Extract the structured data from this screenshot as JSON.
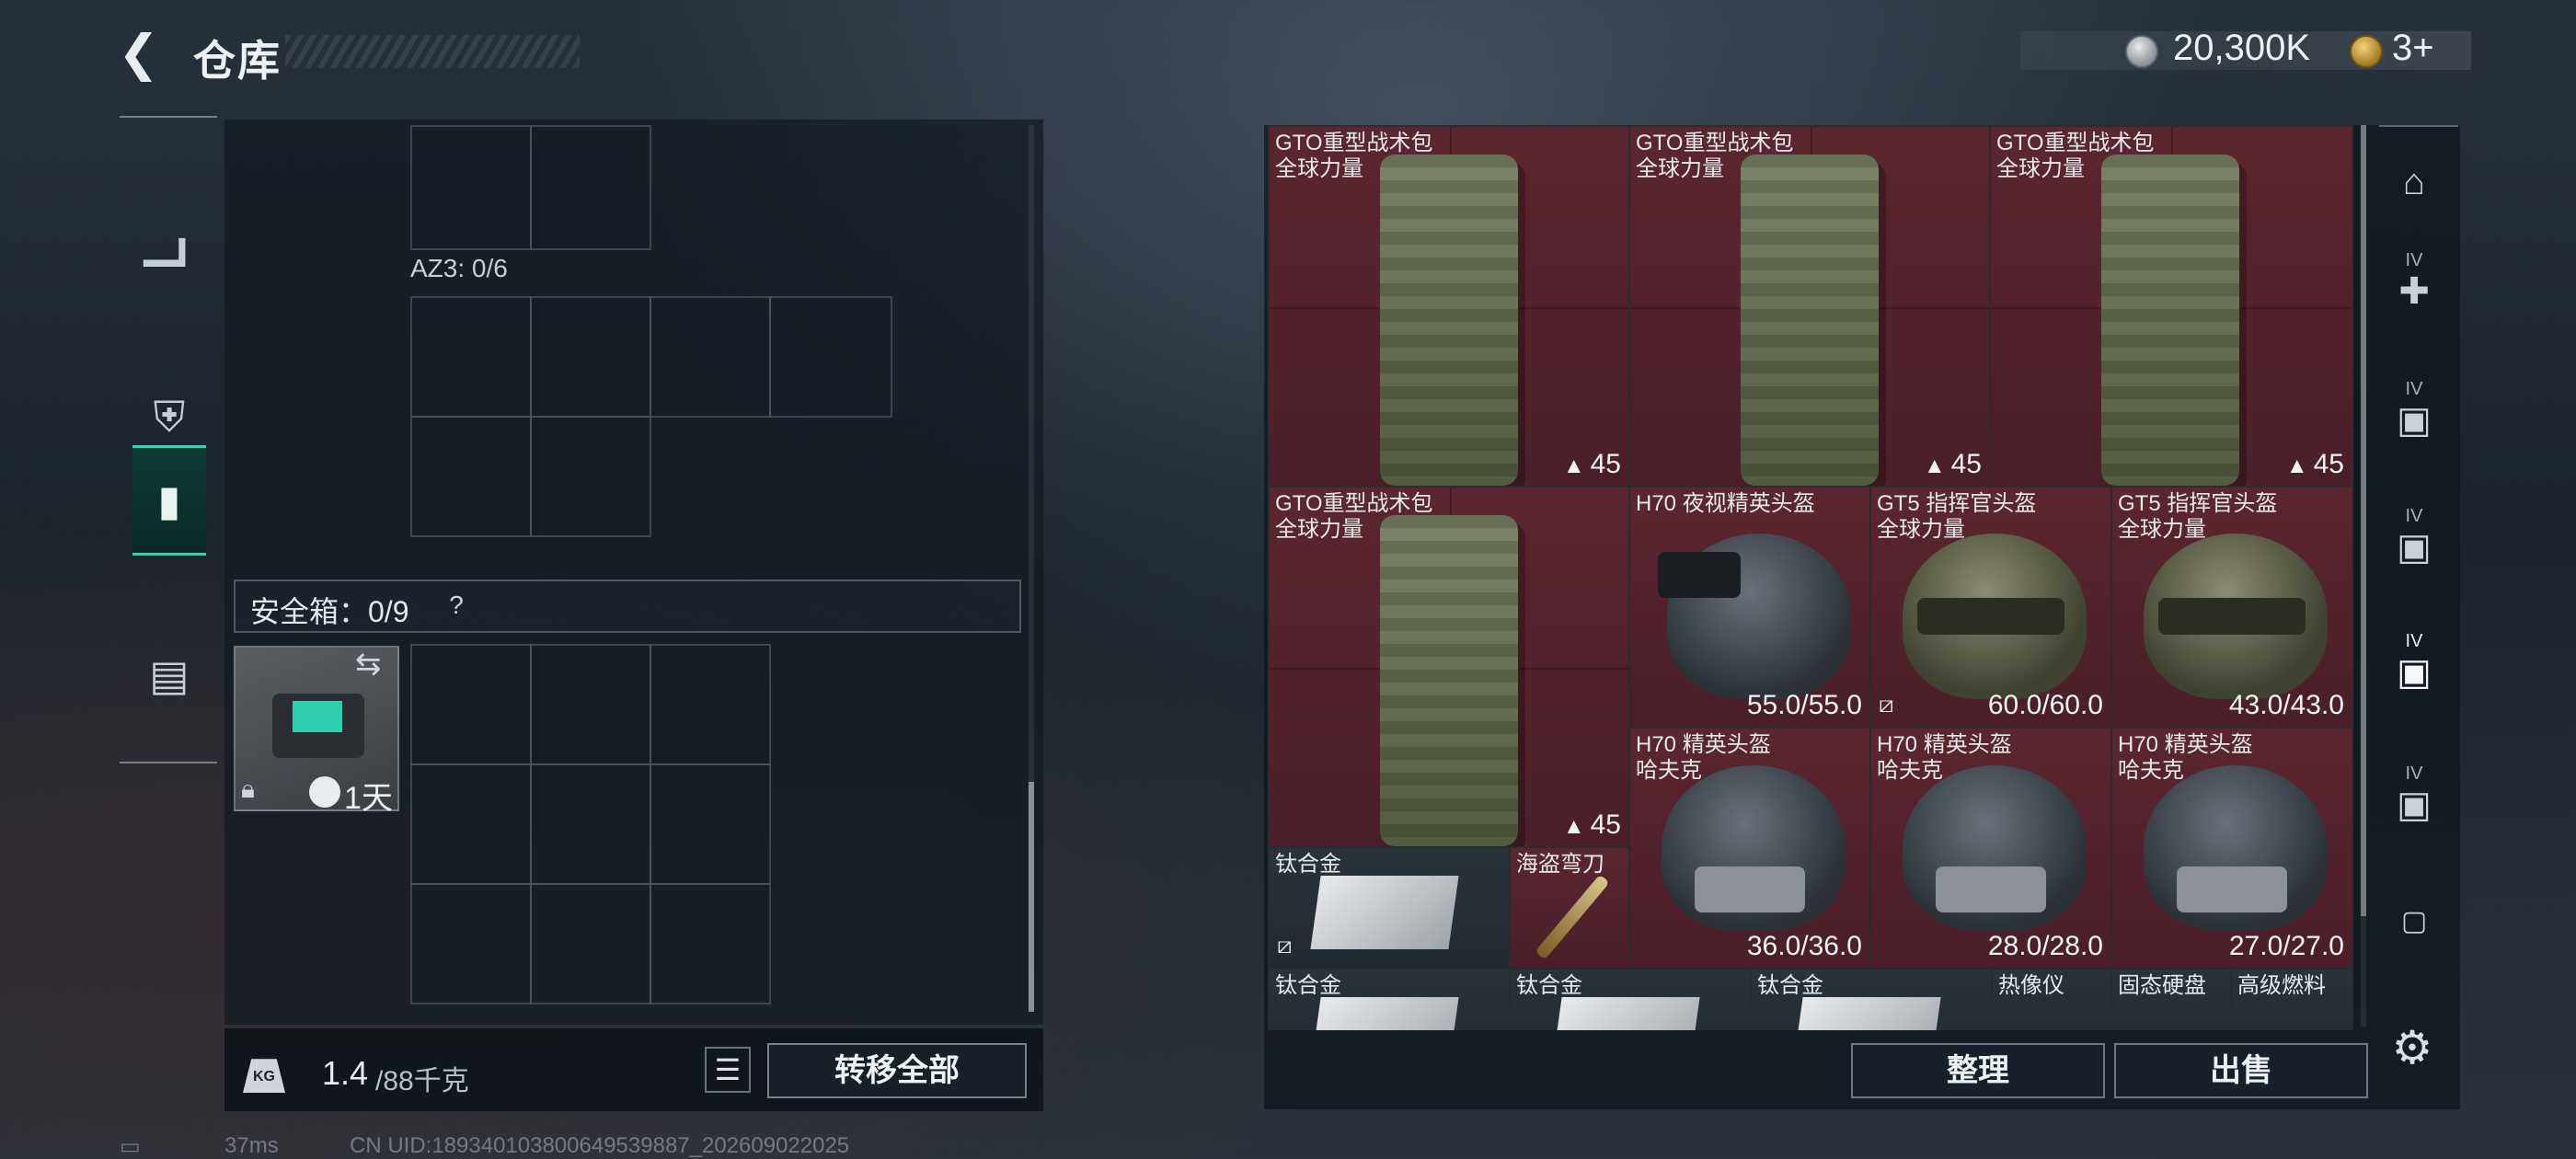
{
  "header": {
    "back_icon": "back-arrow-icon",
    "title": "仓库",
    "currency": {
      "coin_value": "20,300K",
      "ticket_value": "3+"
    }
  },
  "left_rail": {
    "items": [
      {
        "name": "weapon",
        "icon": "pistol-icon"
      },
      {
        "name": "armor",
        "icon": "armor-icon"
      },
      {
        "name": "backpack",
        "icon": "backpack-icon",
        "active": true
      },
      {
        "name": "case",
        "icon": "briefcase-icon"
      }
    ]
  },
  "container": {
    "az3_label": "AZ3: 0/6",
    "safebox_label": "安全箱：0/9",
    "safebox_help": "?",
    "safebox_days": "1天"
  },
  "weight": {
    "current": "1.4",
    "max": "/88千克"
  },
  "buttons": {
    "transfer_all": "转移全部",
    "sort": "整理",
    "sell": "出售"
  },
  "status": {
    "ping": "37ms",
    "uid": "CN UID:189340103800649539887_202609022025"
  },
  "stash_items": [
    {
      "name": "GTO重型战术包",
      "sub": "全球力量",
      "stat": "45"
    },
    {
      "name": "GTO重型战术包",
      "sub": "全球力量",
      "stat": "45"
    },
    {
      "name": "GTO重型战术包",
      "sub": "全球力量",
      "stat": "45"
    },
    {
      "name": "GTO重型战术包",
      "sub": "全球力量",
      "stat": "45"
    },
    {
      "name": "H70 夜视精英头盔",
      "sub": "",
      "stat": "55.0/55.0"
    },
    {
      "name": "GT5 指挥官头盔",
      "sub": "全球力量",
      "stat": "60.0/60.0"
    },
    {
      "name": "GT5 指挥官头盔",
      "sub": "全球力量",
      "stat": "43.0/43.0"
    },
    {
      "name": "H70 精英头盔",
      "sub": "哈夫克",
      "stat": "36.0/36.0"
    },
    {
      "name": "H70 精英头盔",
      "sub": "哈夫克",
      "stat": "28.0/28.0"
    },
    {
      "name": "H70 精英头盔",
      "sub": "哈夫克",
      "stat": "27.0/27.0"
    },
    {
      "name": "钛合金",
      "sub": "",
      "stat": ""
    },
    {
      "name": "海盗弯刀",
      "sub": "",
      "stat": ""
    },
    {
      "name": "钛合金",
      "sub": "",
      "stat": ""
    },
    {
      "name": "钛合金",
      "sub": "",
      "stat": ""
    },
    {
      "name": "钛合金",
      "sub": "",
      "stat": ""
    },
    {
      "name": "热像仪",
      "sub": "",
      "stat": ""
    },
    {
      "name": "固态硬盘",
      "sub": "",
      "stat": ""
    },
    {
      "name": "高级燃料",
      "sub": "",
      "stat": ""
    }
  ],
  "right_rail": {
    "items": [
      {
        "label": "",
        "icon": "stash-home-icon"
      },
      {
        "label": "IV",
        "icon": "expand-add-icon"
      },
      {
        "label": "IV",
        "icon": "container-icon"
      },
      {
        "label": "IV",
        "icon": "container-icon"
      },
      {
        "label": "IV",
        "icon": "container-active-icon"
      },
      {
        "label": "IV",
        "icon": "container-icon"
      },
      {
        "label": "",
        "icon": "lock-icon"
      }
    ],
    "settings_icon": "gear-icon"
  },
  "colors": {
    "accent": "#27d9b0",
    "item_red": "#5b2630",
    "panel": "#121a21"
  }
}
